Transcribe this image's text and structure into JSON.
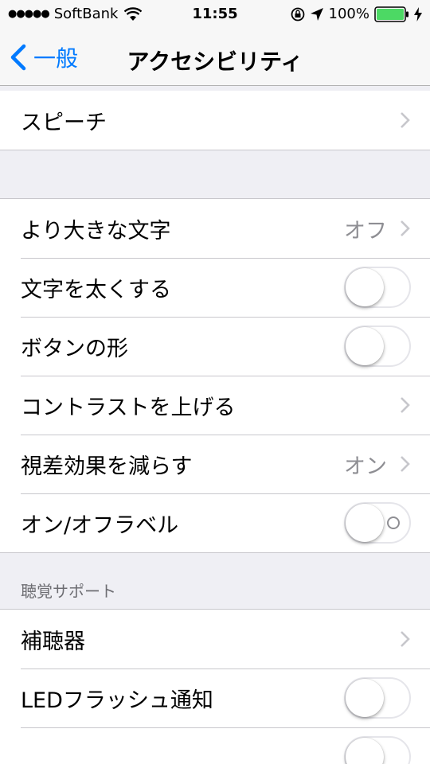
{
  "status_bar": {
    "signal_dots": "●●●●●",
    "carrier": "SoftBank",
    "time": "11:55",
    "battery_percent": "100%",
    "battery_level": 1.0
  },
  "nav": {
    "back_label": "一般",
    "title": "アクセシビリティ"
  },
  "group1": {
    "speech": "スピーチ"
  },
  "group2": {
    "larger_text": {
      "label": "より大きな文字",
      "value": "オフ"
    },
    "bold_text": {
      "label": "文字を太くする",
      "on": false
    },
    "button_shapes": {
      "label": "ボタンの形",
      "on": false
    },
    "increase_contrast": {
      "label": "コントラストを上げる"
    },
    "reduce_motion": {
      "label": "視差効果を減らす",
      "value": "オン"
    },
    "on_off_labels": {
      "label": "オン/オフラベル",
      "on": false
    }
  },
  "hearing": {
    "header": "聴覚サポート",
    "hearing_aids": "補聴器",
    "led_flash": {
      "label": "LEDフラッシュ通知",
      "on": false
    }
  },
  "colors": {
    "accent": "#007aff",
    "background": "#efeff4",
    "separator": "#c8c7cc",
    "secondary_text": "#8e8e93",
    "battery_green": "#4cd964"
  }
}
